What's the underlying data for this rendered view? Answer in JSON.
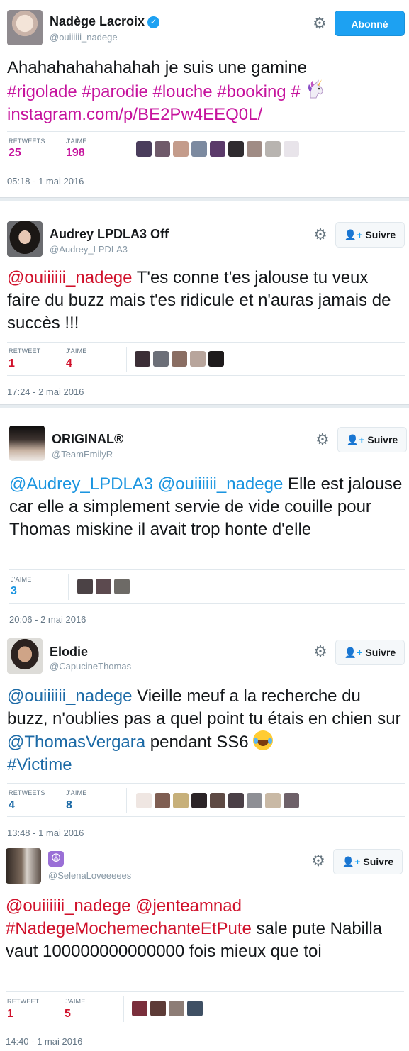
{
  "ui": {
    "follow_label": "Suivre",
    "following_label": "Abonné"
  },
  "tweets": [
    {
      "author": "Nadège Lacroix",
      "handle": "@ouiiiiii_nadege",
      "verified": true,
      "button": "Abonné",
      "text_parts": [
        {
          "t": "Ahahahahahahahah je suis une gamine",
          "c": "plain"
        },
        {
          "t": "#rigolade #parodie #louche #booking #",
          "c": "pink"
        },
        {
          "t": "instagram.com/p/BE2Pw4EEQ0L/",
          "c": "pink"
        }
      ],
      "stats": [
        {
          "label": "RETWEETS",
          "value": "25"
        },
        {
          "label": "J'AIME",
          "value": "198"
        }
      ],
      "accent": "#c6139d",
      "timestamp": "05:18 - 1 mai 2016"
    },
    {
      "author": "Audrey LPDLA3 Off",
      "handle": "@Audrey_LPDLA3",
      "button": "Suivre",
      "text_parts": [
        {
          "t": "@ouiiiiii_nadege",
          "c": "red"
        },
        {
          "t": " T'es conne t'es jalouse tu veux faire du buzz mais t'es ridicule et n'auras jamais de succès !!!",
          "c": "plain"
        }
      ],
      "stats": [
        {
          "label": "RETWEET",
          "value": "1"
        },
        {
          "label": "J'AIME",
          "value": "4"
        }
      ],
      "accent": "#d0112b",
      "timestamp": "17:24 - 2 mai 2016"
    },
    {
      "author": "ORIGINAL®",
      "handle": "@TeamEmilyR",
      "button": "Suivre",
      "text_parts": [
        {
          "t": "@Audrey_LPDLA3 @ouiiiiii_nadege",
          "c": "blue"
        },
        {
          "t": " Elle est jalouse car elle a simplement servie de vide couille pour Thomas miskine il avait trop honte d'elle",
          "c": "plain"
        }
      ],
      "stats": [
        {
          "label": "J'AIME",
          "value": "3"
        }
      ],
      "accent": "#1b95e0",
      "timestamp": "20:06 - 2 mai 2016"
    },
    {
      "author": "Elodie",
      "handle": "@CapucineThomas",
      "button": "Suivre",
      "text_parts": [
        {
          "t": "@ouiiiiii_nadege",
          "c": "navy"
        },
        {
          "t": " Vieille meuf a la recherche du buzz, n'oublies pas a quel point tu étais en chien sur ",
          "c": "plain"
        },
        {
          "t": "@ThomasVergara",
          "c": "navy"
        },
        {
          "t": " pendant SS6 ",
          "c": "plain"
        },
        {
          "t": "#Victime",
          "c": "navy"
        }
      ],
      "stats": [
        {
          "label": "RETWEETS",
          "value": "4"
        },
        {
          "label": "J'AIME",
          "value": "8"
        }
      ],
      "accent": "#1c6aa6",
      "timestamp": "13:48 - 1 mai 2016"
    },
    {
      "author": "",
      "handle": "@SelenaLoveeeees",
      "button": "Suivre",
      "text_parts": [
        {
          "t": "@ouiiiiii_nadege @jenteamnad",
          "c": "red"
        },
        {
          "t": "#NadegeMochemechanteEtPute",
          "c": "red"
        },
        {
          "t": "  sale pute Nabilla vaut 100000000000000 fois mieux que toi",
          "c": "plain"
        }
      ],
      "stats": [
        {
          "label": "RETWEET",
          "value": "1"
        },
        {
          "label": "J'AIME",
          "value": "5"
        }
      ],
      "accent": "#d0112b",
      "timestamp": "14:40 - 1 mai 2016"
    }
  ],
  "icons": {
    "gear": "gear-icon",
    "verified": "verified-badge-icon",
    "follow": "follow-person-icon",
    "peace": "peace-symbol-icon",
    "unicorn": "unicorn-emoji-icon",
    "laugh": "tears-of-joy-emoji-icon"
  }
}
